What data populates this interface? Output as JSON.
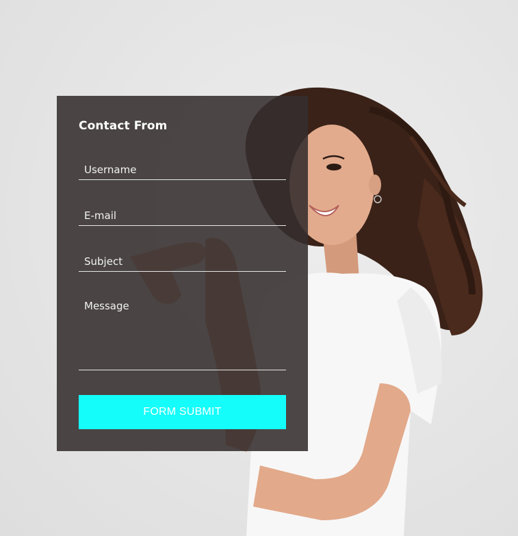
{
  "form": {
    "title": "Contact From",
    "fields": {
      "username_placeholder": "Username",
      "email_placeholder": "E-mail",
      "subject_placeholder": "Subject",
      "message_placeholder": "Message"
    },
    "submit_label": "FORM SUBMIT"
  },
  "colors": {
    "card_background": "#342e2d",
    "submit_background": "#14fdfa",
    "text": "#ffffff",
    "page_background": "#e6e6e6"
  }
}
